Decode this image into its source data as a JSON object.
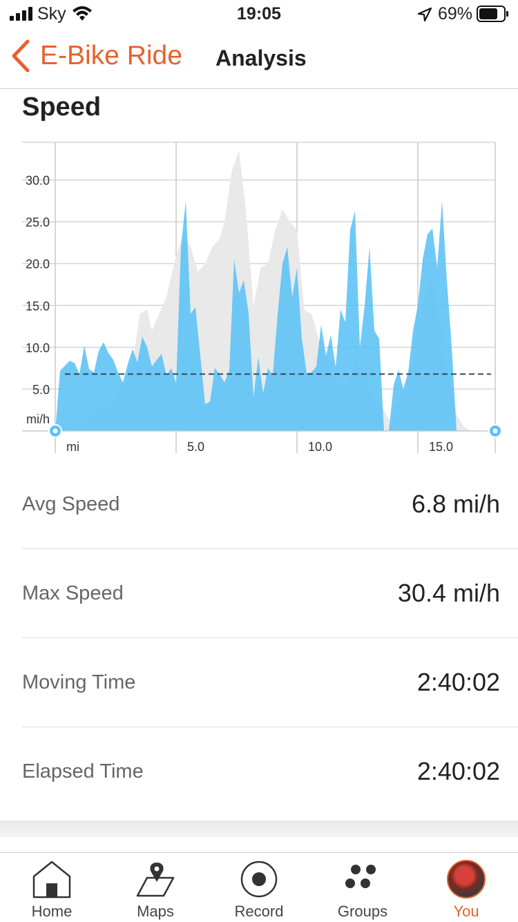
{
  "status": {
    "carrier": "Sky",
    "time": "19:05",
    "battery_percent": "69%"
  },
  "header": {
    "back_label": "E-Bike Ride",
    "title": "Analysis"
  },
  "section": {
    "title": "Speed"
  },
  "chart_data": {
    "type": "area",
    "ylabel": "mi/h",
    "xlabel": "mi",
    "x_ticks": [
      "mi",
      "5.0",
      "10.0",
      "15.0"
    ],
    "y_ticks": [
      "5.0",
      "10.0",
      "15.0",
      "20.0",
      "25.0",
      "30.0"
    ],
    "xlim": [
      0,
      18.2
    ],
    "ylim": [
      0,
      34.5
    ],
    "average": 6.8,
    "grid": true,
    "series": [
      {
        "color": "#5bc2f5",
        "x": [
          0,
          0.2,
          0.6,
          0.8,
          1.0,
          1.2,
          1.4,
          1.6,
          1.8,
          2.0,
          2.2,
          2.4,
          2.6,
          2.8,
          3.0,
          3.2,
          3.4,
          3.6,
          3.8,
          4.0,
          4.2,
          4.4,
          4.6,
          4.8,
          5.0,
          5.2,
          5.4,
          5.6,
          5.8,
          6.0,
          6.2,
          6.4,
          6.6,
          6.8,
          7.0,
          7.2,
          7.4,
          7.6,
          7.8,
          8.0,
          8.2,
          8.4,
          8.6,
          8.8,
          9.0,
          9.2,
          9.4,
          9.6,
          9.8,
          10.0,
          10.2,
          10.4,
          10.6,
          10.8,
          11.0,
          11.2,
          11.4,
          11.6,
          11.8,
          12.0,
          12.2,
          12.4,
          12.6,
          12.8,
          13.0,
          13.2,
          13.4,
          13.6,
          13.8,
          14.0,
          14.2,
          14.4,
          14.6,
          14.8,
          15.0,
          15.2,
          15.4,
          15.6,
          15.8,
          16.0,
          16.2,
          16.4,
          16.6,
          16.8,
          17.0,
          17.2,
          17.4,
          17.6,
          17.8,
          18.0,
          18.2
        ],
        "y": [
          0,
          7.2,
          8.4,
          8.1,
          6.8,
          10.2,
          7.4,
          7.0,
          9.6,
          10.6,
          9.3,
          8.5,
          7.0,
          5.8,
          8.0,
          9.8,
          8.2,
          11.3,
          10.0,
          7.7,
          8.5,
          9.2,
          6.6,
          7.5,
          5.7,
          22.0,
          27.5,
          14.0,
          14.8,
          9.0,
          3.2,
          3.5,
          7.5,
          6.8,
          5.8,
          7.2,
          20.5,
          16.5,
          18.0,
          14.0,
          4.0,
          8.8,
          4.5,
          7.5,
          6.7,
          14.0,
          20.0,
          22.0,
          16.0,
          19.5,
          11.0,
          6.9,
          7.0,
          7.7,
          12.7,
          9.0,
          11.5,
          7.6,
          14.5,
          13.0,
          24.0,
          26.3,
          10.0,
          15.0,
          22.0,
          12.0,
          11.0,
          0,
          0,
          5.5,
          7.3,
          5.0,
          7.0,
          12.0,
          15.0,
          20.5,
          23.5,
          24.2,
          19.5,
          27.5,
          18.0,
          10.0,
          0,
          0,
          0,
          0,
          0,
          0,
          0,
          0,
          0
        ]
      },
      {
        "color": "#e9e9e9",
        "x": [
          0,
          0.5,
          1.0,
          1.5,
          2.0,
          2.5,
          3.0,
          3.2,
          3.5,
          3.8,
          4.0,
          4.3,
          4.6,
          5.0,
          5.3,
          5.6,
          5.9,
          6.2,
          6.5,
          6.8,
          7.0,
          7.3,
          7.6,
          7.9,
          8.2,
          8.5,
          8.8,
          9.1,
          9.4,
          9.7,
          10.0,
          10.3,
          10.6,
          10.9,
          11.2,
          11.5,
          11.8,
          12.1,
          12.4,
          12.7,
          13.0,
          13.3,
          13.6,
          13.9,
          14.2,
          14.5,
          14.8,
          15.1,
          15.4,
          15.7,
          16.0,
          16.3,
          16.6,
          16.9,
          17.2,
          17.5,
          17.8,
          18.0,
          18.2
        ],
        "y": [
          0,
          0.5,
          1.0,
          2.0,
          3.0,
          4.0,
          7.0,
          8.0,
          14.0,
          14.5,
          12.0,
          14.0,
          16.0,
          21.0,
          23.5,
          22.0,
          19.0,
          20.0,
          22.0,
          23.0,
          25.0,
          31.0,
          33.5,
          26.0,
          15.0,
          19.5,
          20.0,
          24.0,
          26.5,
          25.0,
          24.0,
          14.5,
          14.0,
          11.0,
          8.0,
          6.5,
          5.0,
          5.5,
          8.5,
          7.0,
          5.5,
          3.5,
          2.5,
          1.0,
          3.5,
          6.0,
          8.5,
          13.0,
          18.5,
          17.0,
          11.0,
          6.0,
          2.0,
          0.5,
          0,
          0,
          0,
          0,
          0
        ]
      }
    ]
  },
  "stats": [
    {
      "label": "Avg Speed",
      "value": "6.8 mi/h"
    },
    {
      "label": "Max Speed",
      "value": "30.4 mi/h"
    },
    {
      "label": "Moving Time",
      "value": "2:40:02"
    },
    {
      "label": "Elapsed Time",
      "value": "2:40:02"
    }
  ],
  "tabs": [
    {
      "label": "Home",
      "icon": "home-icon"
    },
    {
      "label": "Maps",
      "icon": "map-icon"
    },
    {
      "label": "Record",
      "icon": "record-icon"
    },
    {
      "label": "Groups",
      "icon": "groups-icon"
    },
    {
      "label": "You",
      "icon": "avatar",
      "active": true
    }
  ],
  "colors": {
    "accent": "#e8602c",
    "series_primary": "#5bc2f5",
    "series_compare": "#e9e9e9"
  }
}
